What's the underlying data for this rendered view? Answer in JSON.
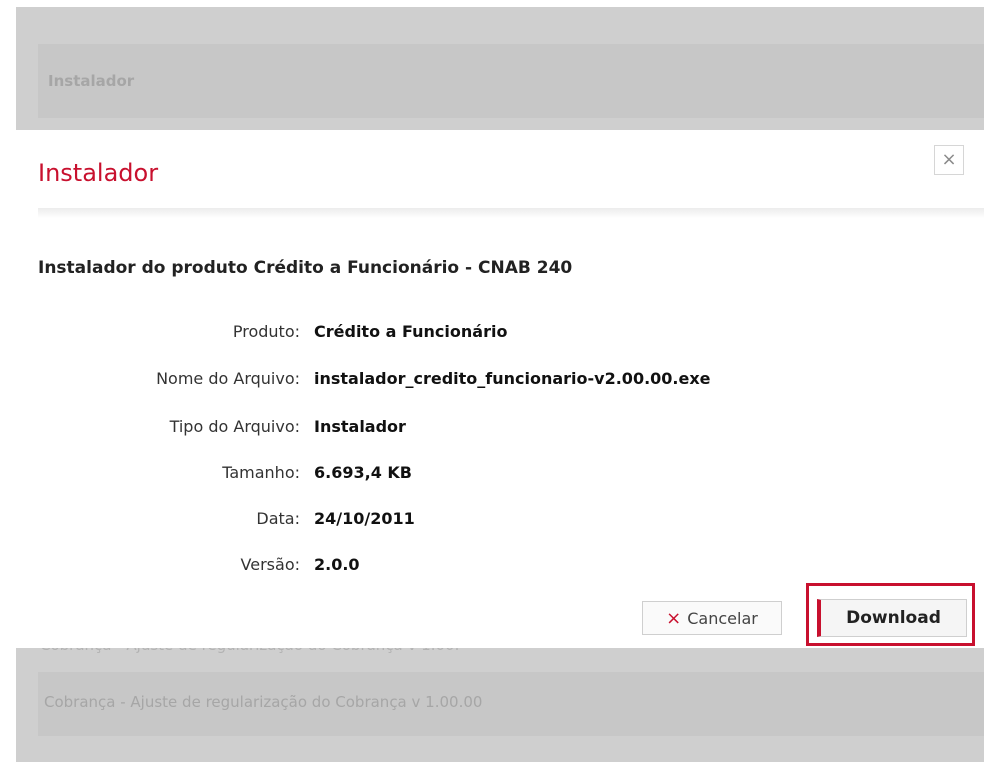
{
  "background": {
    "panel_title": "Instalador",
    "partial_row_text": "Cobrança - Ajuste de regularização do Cobrança v 1.00.00",
    "row_text": "Cobrança - Ajuste de regularização do Cobrança v 1.00.00"
  },
  "modal": {
    "title": "Instalador",
    "close_glyph": "×",
    "subtitle": "Instalador do produto Crédito a Funcionário - CNAB 240",
    "fields": [
      {
        "label": "Produto:",
        "value": "Crédito a Funcionário"
      },
      {
        "label": "Nome do Arquivo:",
        "value": "instalador_credito_funcionario-v2.00.00.exe"
      },
      {
        "label": "Tipo do Arquivo:",
        "value": "Instalador"
      },
      {
        "label": "Tamanho:",
        "value": "6.693,4 KB"
      },
      {
        "label": "Data:",
        "value": "24/10/2011"
      },
      {
        "label": "Versão:",
        "value": "2.0.0"
      }
    ],
    "buttons": {
      "cancel_icon": "×",
      "cancel_label": "Cancelar",
      "download_label": "Download"
    }
  },
  "colors": {
    "accent": "#c8102e",
    "overlay": "#cfcfcf"
  }
}
